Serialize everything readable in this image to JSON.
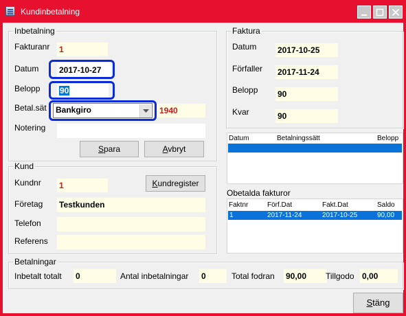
{
  "window": {
    "title": "Kundinbetalning",
    "icon": "app-form-icon",
    "controls": [
      "minimize-icon",
      "maximize-icon",
      "close-icon"
    ]
  },
  "inbetalning": {
    "title": "Inbetalning",
    "fakturanr_label": "Fakturanr",
    "fakturanr_value": "1",
    "datum_label": "Datum",
    "datum_value": "2017-10-27",
    "belopp_label": "Belopp",
    "belopp_value": "90",
    "betalsatt_label": "Betal.sät",
    "betalsatt_value": "Bankgiro",
    "betalsatt_code": "1940",
    "notering_label": "Notering",
    "notering_value": "",
    "spara_label": "Spara",
    "spara_accel": "S",
    "spara_rest": "para",
    "avbryt_label": "Avbryt",
    "avbryt_accel": "A",
    "avbryt_rest": "vbryt"
  },
  "kund": {
    "title": "Kund",
    "kundnr_label": "Kundnr",
    "kundnr_value": "1",
    "kundregister_label": "Kundregister",
    "kundregister_accel": "K",
    "kundregister_rest": "undregister",
    "foretag_label": "Företag",
    "foretag_value": "Testkunden",
    "telefon_label": "Telefon",
    "telefon_value": "",
    "referens_label": "Referens",
    "referens_value": ""
  },
  "faktura": {
    "title": "Faktura",
    "datum_label": "Datum",
    "datum_value": "2017-10-25",
    "forfaller_label": "Förfaller",
    "forfaller_value": "2017-11-24",
    "belopp_label": "Belopp",
    "belopp_value": "90",
    "kvar_label": "Kvar",
    "kvar_value": "90"
  },
  "payments_list": {
    "columns": [
      "Datum",
      "Betalningssätt",
      "Belopp"
    ],
    "rows": []
  },
  "obetalda": {
    "title": "Obetalda fakturor",
    "columns": [
      "Faktnr",
      "Förf.Dat",
      "Fakt.Dat",
      "Saldo"
    ],
    "rows": [
      {
        "faktnr": "1",
        "forf_dat": "2017-11-24",
        "fakt_dat": "2017-10-25",
        "saldo": "90,00"
      }
    ]
  },
  "betalningar": {
    "title": "Betalningar",
    "inbetalt_label": "Inbetalt totalt",
    "inbetalt_value": "0",
    "antal_label": "Antal inbetalningar",
    "antal_value": "0",
    "total_label": "Total fodran",
    "total_value": "90,00",
    "tillgodo_label": "Tillgodo",
    "tillgodo_value": "0,00"
  },
  "stang_label": "Stäng",
  "stang_accel": "S",
  "stang_rest": "täng",
  "colors": {
    "window_frame": "#e8102f",
    "client_bg": "#f0f0f0",
    "field_bg": "#fefee6",
    "focus_ring": "#0a2bd6",
    "selection": "#0a72d8",
    "red_text": "#d21818"
  }
}
